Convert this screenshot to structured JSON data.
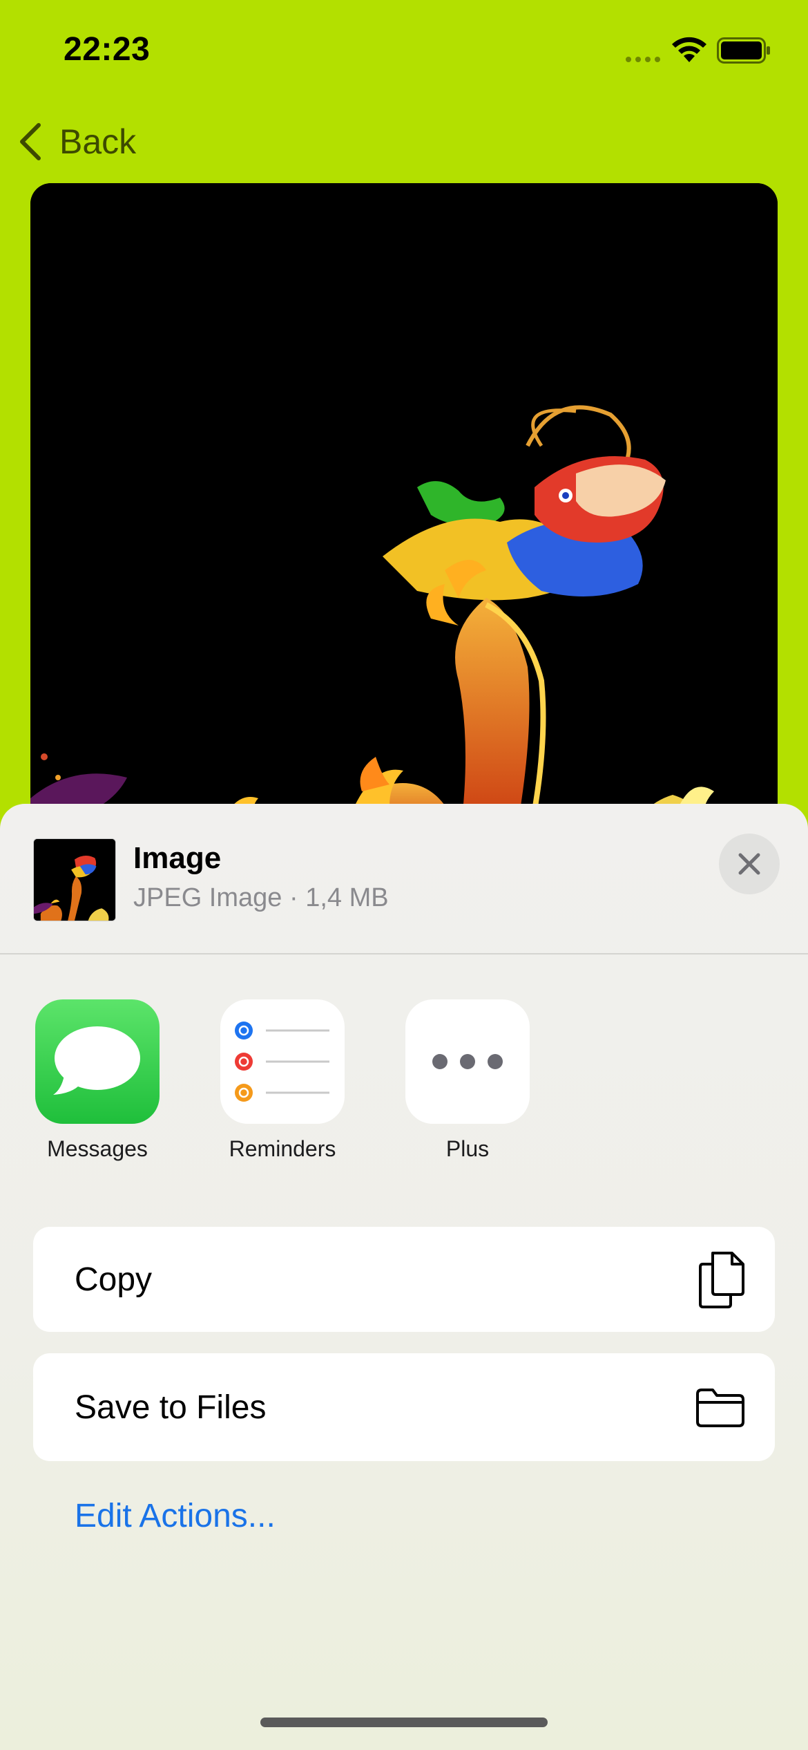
{
  "status_bar": {
    "time": "22:23",
    "signal_icon": "cellular-signal-icon",
    "wifi_icon": "wifi-icon",
    "battery_icon": "battery-full-icon"
  },
  "nav": {
    "back_label": "Back",
    "back_icon": "chevron-left-icon"
  },
  "photo": {
    "background": "#000000"
  },
  "share_sheet": {
    "file_title": "Image",
    "file_meta": "JPEG Image · 1,4 MB",
    "close_icon": "close-x-icon",
    "apps": [
      {
        "label": "Messages",
        "icon": "messages-icon"
      },
      {
        "label": "Reminders",
        "icon": "reminders-icon"
      },
      {
        "label": "Plus",
        "icon": "more-ellipsis-icon"
      }
    ],
    "actions": [
      {
        "label": "Copy",
        "icon": "copy-documents-icon"
      },
      {
        "label": "Save to Files",
        "icon": "folder-icon"
      }
    ],
    "edit_actions_label": "Edit Actions..."
  },
  "colors": {
    "background": "#b3e000",
    "link": "#1a73e8",
    "messages_green": "#2fd04b"
  }
}
